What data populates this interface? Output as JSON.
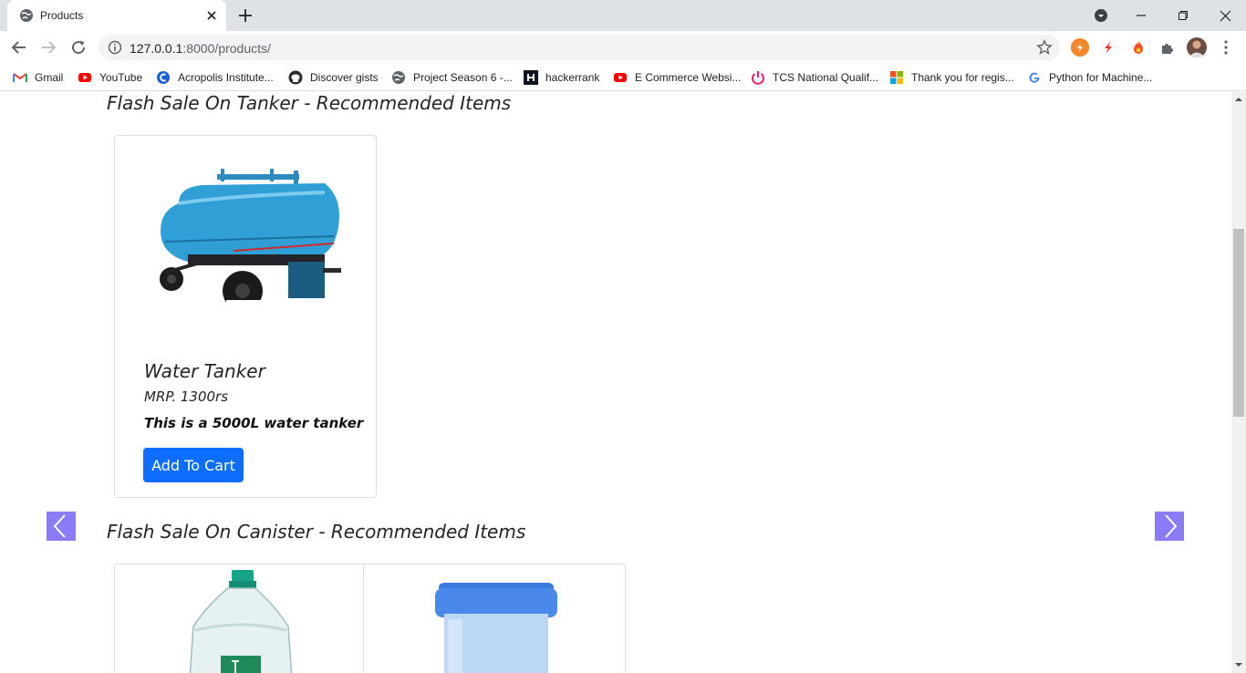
{
  "browser": {
    "tab_title": "Products",
    "url_host": "127.0.0.1",
    "url_rest": ":8000/products/",
    "bookmarks": [
      {
        "label": "Gmail",
        "icon": "gmail-icon"
      },
      {
        "label": "YouTube",
        "icon": "youtube-icon"
      },
      {
        "label": "Acropolis Institute...",
        "icon": "acropolis-icon"
      },
      {
        "label": "Discover gists",
        "icon": "github-icon"
      },
      {
        "label": "Project Season 6 -...",
        "icon": "globe-icon"
      },
      {
        "label": "hackerrank",
        "icon": "hackerrank-icon"
      },
      {
        "label": "E Commerce Websi...",
        "icon": "youtube-icon"
      },
      {
        "label": "TCS National Qualif...",
        "icon": "tcs-icon"
      },
      {
        "label": "Thank you for regis...",
        "icon": "microsoft-icon"
      },
      {
        "label": "Python for Machine...",
        "icon": "google-icon"
      }
    ]
  },
  "sections": [
    {
      "title": "Flash Sale On Tanker - Recommended Items",
      "products": [
        {
          "name": "Water Tanker",
          "price": "MRP. 1300rs",
          "description": "This is a 5000L water tanker",
          "button": "Add To Cart"
        }
      ]
    },
    {
      "title": "Flash Sale On Canister - Recommended Items"
    }
  ],
  "colors": {
    "accent": "#0d6efd",
    "carousel_control": "#8a7cf6"
  }
}
